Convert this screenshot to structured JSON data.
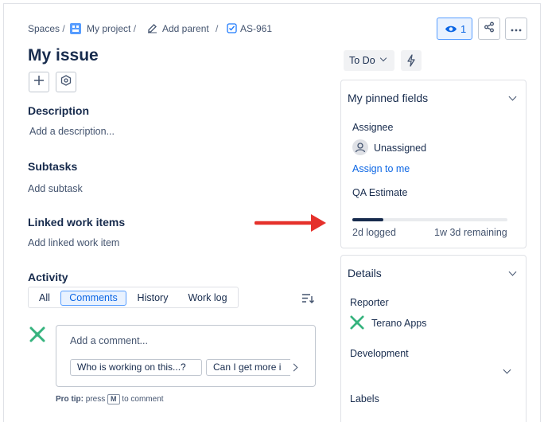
{
  "breadcrumb": {
    "spaces": "Spaces",
    "project": "My project",
    "add_parent": "Add parent",
    "issue_key": "AS-961"
  },
  "header": {
    "watch_count": "1",
    "status": "To Do"
  },
  "issue": {
    "title": "My issue"
  },
  "description": {
    "heading": "Description",
    "placeholder": "Add a description..."
  },
  "subtasks": {
    "heading": "Subtasks",
    "action": "Add subtask"
  },
  "linked": {
    "heading": "Linked work items",
    "action": "Add linked work item"
  },
  "activity": {
    "heading": "Activity",
    "tabs": [
      "All",
      "Comments",
      "History",
      "Work log"
    ],
    "active_tab": "Comments",
    "comment_placeholder": "Add a comment...",
    "suggestions": [
      "Who is working on this...?",
      "Can I get more i"
    ],
    "pro_tip_label": "Pro tip:",
    "pro_tip_text_before": "press",
    "pro_tip_key": "M",
    "pro_tip_text_after": "to comment"
  },
  "pinned": {
    "title": "My pinned fields",
    "assignee_label": "Assignee",
    "assignee_value": "Unassigned",
    "assign_link": "Assign to me",
    "qa_label": "QA Estimate",
    "logged": "2d logged",
    "remaining": "1w 3d remaining",
    "progress_fraction": 0.2
  },
  "details": {
    "title": "Details",
    "reporter_label": "Reporter",
    "reporter_value": "Terano Apps",
    "development_label": "Development",
    "labels_label": "Labels"
  },
  "colors": {
    "accent": "#0c66e4",
    "arrow": "#e5312b",
    "logo": "#36b37e"
  }
}
